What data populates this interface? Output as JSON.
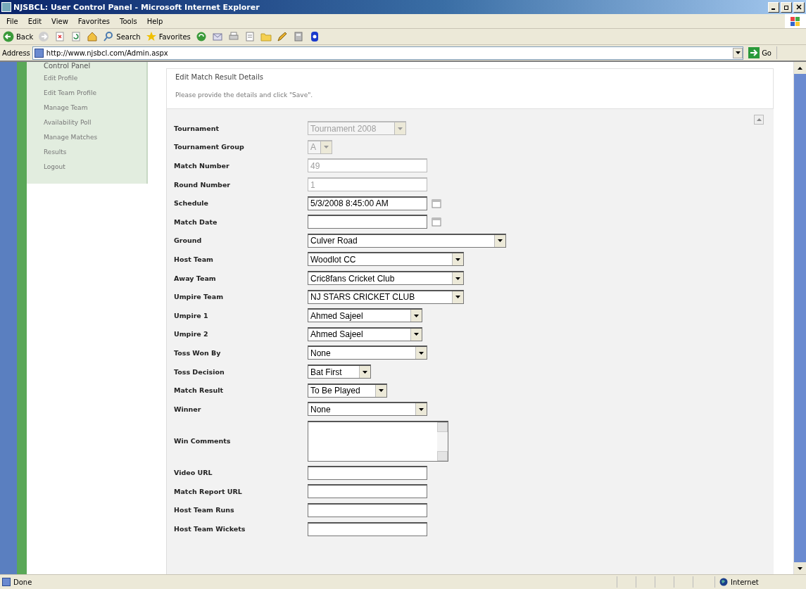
{
  "window": {
    "title": "NJSBCL: User Control Panel - Microsoft Internet Explorer"
  },
  "menu": [
    "File",
    "Edit",
    "View",
    "Favorites",
    "Tools",
    "Help"
  ],
  "toolbar": [
    {
      "kind": "back",
      "label": "Back"
    },
    {
      "kind": "forward"
    },
    {
      "kind": "stop"
    },
    {
      "kind": "refresh"
    },
    {
      "kind": "home"
    },
    {
      "kind": "search",
      "label": "Search"
    },
    {
      "kind": "favorites",
      "label": "Favorites"
    },
    {
      "kind": "media"
    },
    {
      "kind": "mail"
    },
    {
      "kind": "print"
    },
    {
      "kind": "edit"
    },
    {
      "kind": "folder"
    },
    {
      "kind": "pencil"
    },
    {
      "kind": "research"
    },
    {
      "kind": "messenger"
    }
  ],
  "address": {
    "label": "Address",
    "url": "http://www.njsbcl.com/Admin.aspx",
    "go": "Go"
  },
  "sidebar": {
    "heading": "Control Panel",
    "items": [
      "Edit Profile",
      "Edit Team Profile",
      "Manage Team",
      "Availability Poll",
      "Manage Matches",
      "Results",
      "Logout"
    ]
  },
  "panel": {
    "title": "Edit Match Result Details",
    "hint": "Please provide the details and click \"Save\"."
  },
  "form": [
    {
      "label": "Tournament",
      "kind": "select",
      "value": "Tournament 2008",
      "disabled": true
    },
    {
      "label": "Tournament Group",
      "kind": "select",
      "value": "A",
      "disabled": true
    },
    {
      "label": "Match Number",
      "kind": "text",
      "value": "49",
      "disabled": true
    },
    {
      "label": "Round Number",
      "kind": "text",
      "value": "1",
      "disabled": true
    },
    {
      "label": "Schedule",
      "kind": "date",
      "value": "5/3/2008 8:45:00 AM",
      "disabled": false
    },
    {
      "label": "Match Date",
      "kind": "date",
      "disabled": false
    },
    {
      "label": "Ground",
      "kind": "select",
      "value": "Culver Road",
      "disabled": false
    },
    {
      "label": "Host Team",
      "kind": "select",
      "value": "Woodlot CC",
      "disabled": false
    },
    {
      "label": "Away Team",
      "kind": "select",
      "value": "Cric8fans Cricket Club",
      "disabled": false
    },
    {
      "label": "Umpire Team",
      "kind": "select",
      "value": "NJ STARS CRICKET CLUB",
      "disabled": false
    },
    {
      "label": "Umpire 1",
      "kind": "select",
      "value": "Ahmed Sajeel",
      "disabled": false
    },
    {
      "label": "Umpire 2",
      "kind": "select",
      "value": "Ahmed Sajeel",
      "disabled": false
    },
    {
      "label": "Toss Won By",
      "kind": "select",
      "value": "None",
      "disabled": false
    },
    {
      "label": "Toss Decision",
      "kind": "select",
      "value": "Bat First",
      "disabled": false
    },
    {
      "label": "Match Result",
      "kind": "select",
      "value": "To Be Played",
      "disabled": false
    },
    {
      "label": "Winner",
      "kind": "select",
      "value": "None",
      "disabled": false
    },
    {
      "label": "Win Comments",
      "kind": "textarea",
      "disabled": false
    },
    {
      "label": "Video URL",
      "kind": "text",
      "disabled": false
    },
    {
      "label": "Match Report URL",
      "kind": "text",
      "disabled": false
    },
    {
      "label": "Host Team Runs",
      "kind": "text",
      "disabled": false
    },
    {
      "label": "Host Team Wickets",
      "kind": "text",
      "disabled": false
    }
  ],
  "status_bar": {
    "text": "Done",
    "zone": "Internet"
  }
}
